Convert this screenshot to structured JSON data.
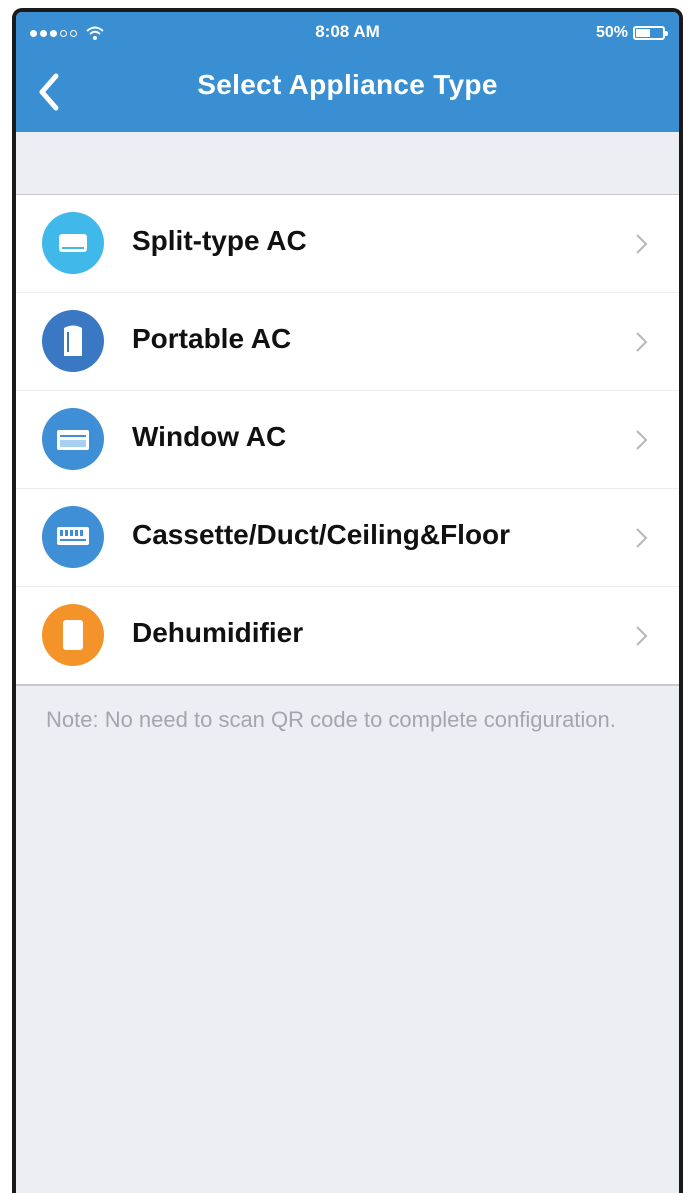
{
  "status_bar": {
    "time": "8:08 AM",
    "battery": "50%",
    "battery_level": 0.5
  },
  "nav": {
    "title": "Select Appliance Type",
    "back_icon": "chevron-left-icon"
  },
  "appliances": [
    {
      "label": "Split-type AC",
      "icon": "split-ac-icon",
      "color": "#40b9ea"
    },
    {
      "label": "Portable AC",
      "icon": "portable-ac-icon",
      "color": "#3b78c4"
    },
    {
      "label": "Window AC",
      "icon": "window-ac-icon",
      "color": "#3f8fd6"
    },
    {
      "label": "Cassette/Duct/Ceiling&Floor",
      "icon": "cassette-ac-icon",
      "color": "#3f8fd6"
    },
    {
      "label": "Dehumidifier",
      "icon": "dehumidifier-icon",
      "color": "#f39329"
    }
  ],
  "note": "Note: No need to scan QR code to complete configuration.",
  "colors": {
    "header": "#3a8fd3",
    "background": "#eceef3",
    "note_text": "#a4a6ad"
  }
}
